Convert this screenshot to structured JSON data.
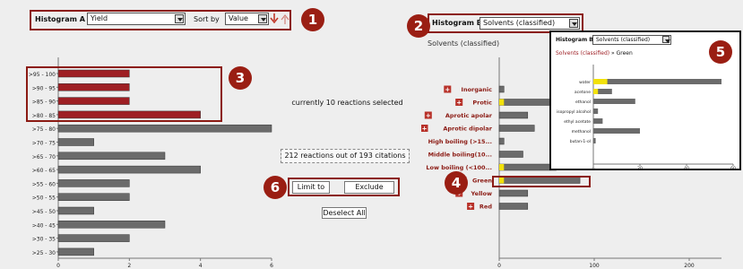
{
  "histogram_a": {
    "label": "Histogram A",
    "field": "Yield",
    "sort_label": "Sort by",
    "sort_value": "Value",
    "chart_data": {
      "type": "bar",
      "categories": [
        ">95 - 100",
        ">90 - 95",
        ">85 - 90",
        ">80 - 85",
        ">75 - 80",
        ">70 - 75",
        ">65 - 70",
        ">60 - 65",
        ">55 - 60",
        ">50 - 55",
        ">45 - 50",
        ">40 - 45",
        ">30 - 35",
        ">25 - 30"
      ],
      "values": [
        2,
        2,
        2,
        4,
        6,
        1,
        3,
        4,
        2,
        2,
        1,
        3,
        2,
        1
      ],
      "selected": [
        true,
        true,
        true,
        true,
        false,
        false,
        false,
        false,
        false,
        false,
        false,
        false,
        false,
        false
      ],
      "xlim": [
        0,
        6
      ],
      "xticks": [
        "0",
        "2",
        "4",
        "6"
      ]
    }
  },
  "middle": {
    "selection_text": "currently 10 reactions selected",
    "count_text": "212 reactions out of 193 citations",
    "limit_label": "Limit to",
    "exclude_label": "Exclude",
    "deselect_label": "Deselect All"
  },
  "histogram_b": {
    "label": "Histogram B",
    "field": "Solvents (classified)",
    "chart_title": "Solvents (classified)",
    "chart_data": {
      "type": "bar",
      "categories": [
        "Inorganic",
        "Protic",
        "Aprotic apolar",
        "Aprotic dipolar",
        "High boiling (>15...",
        "Middle boiling(10...",
        "Low boiling (<100...",
        "Green",
        "Yellow",
        "Red"
      ],
      "values": [
        5,
        105,
        30,
        37,
        5,
        25,
        60,
        85,
        30,
        30
      ],
      "selected": [
        0,
        5,
        0,
        0,
        0,
        0,
        5,
        5,
        0,
        0
      ],
      "xlim": [
        0,
        250
      ],
      "xticks": [
        "0",
        "100",
        "200"
      ]
    }
  },
  "popup": {
    "label": "Histogram B",
    "field": "Solvents (classified)",
    "breadcrumb_parent": "Solvents (classified)",
    "breadcrumb_sep": "»",
    "breadcrumb_current": "Green",
    "chart_data": {
      "type": "bar",
      "categories": [
        "water",
        "acetone",
        "ethanol",
        "isopropyl alcohol",
        "ethyl acetate",
        "methanol",
        "butan-1-ol"
      ],
      "values": [
        55,
        8,
        18,
        2,
        4,
        20,
        1
      ],
      "selected": [
        6,
        2,
        0,
        0,
        0,
        0,
        0
      ],
      "xlim": [
        0,
        60
      ],
      "xticks": [
        "0",
        "20",
        "40",
        "60"
      ]
    }
  },
  "callouts": [
    "1",
    "2",
    "3",
    "4",
    "5",
    "6"
  ],
  "colors": {
    "selected_bar": "#9e1f24",
    "bar": "#6b6b6b",
    "highlight": "#f2e10a",
    "callout": "#8b1a13"
  }
}
